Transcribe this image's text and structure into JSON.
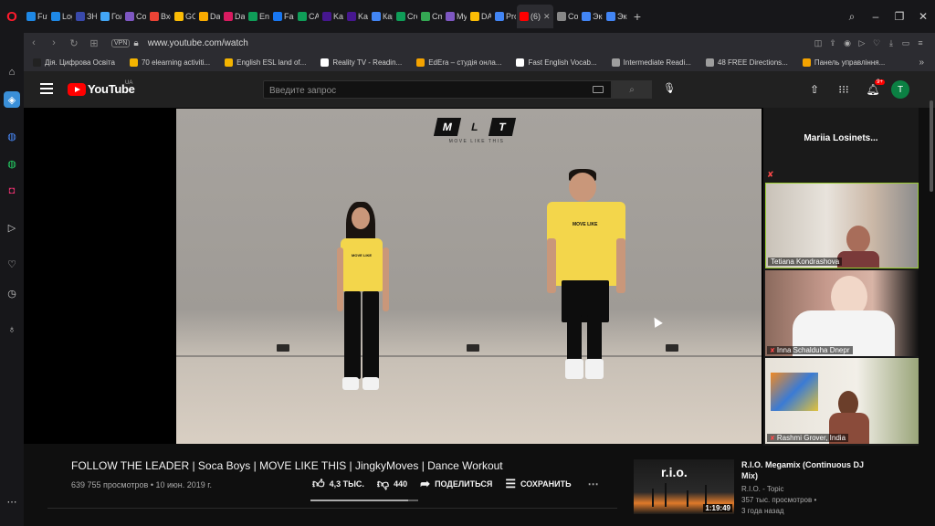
{
  "browser": {
    "tabs": [
      {
        "label": "Fut",
        "color": "#1e88e5"
      },
      {
        "label": "Log",
        "color": "#1e88e5"
      },
      {
        "label": "ЗНО",
        "color": "#3949ab"
      },
      {
        "label": "Гол",
        "color": "#42a5f5"
      },
      {
        "label": "Col",
        "color": "#7e57c2"
      },
      {
        "label": "Вхо",
        "color": "#ea4335"
      },
      {
        "label": "GO",
        "color": "#fbbc05"
      },
      {
        "label": "Day",
        "color": "#f9ab00"
      },
      {
        "label": "Das",
        "color": "#d81b60"
      },
      {
        "label": "Ene",
        "color": "#0f9d58"
      },
      {
        "label": "Fac",
        "color": "#1877f2"
      },
      {
        "label": "CAI",
        "color": "#0f9d58"
      },
      {
        "label": "Kah",
        "color": "#46178f"
      },
      {
        "label": "Kah",
        "color": "#46178f"
      },
      {
        "label": "Кар",
        "color": "#4285f4"
      },
      {
        "label": "Cre",
        "color": "#0f9d58"
      },
      {
        "label": "Cm",
        "color": "#34a853"
      },
      {
        "label": "My",
        "color": "#7e57c2"
      },
      {
        "label": "DAY",
        "color": "#fbbc05"
      },
      {
        "label": "Pro",
        "color": "#4285f4"
      },
      {
        "label": "(6)",
        "color": "#ff0000",
        "active": true
      },
      {
        "label": "Col",
        "color": "#888888"
      },
      {
        "label": "Экс",
        "color": "#4285f4"
      },
      {
        "label": "Экс",
        "color": "#4285f4"
      }
    ],
    "tab_close": "✕",
    "new_tab": "+",
    "url": "www.youtube.com/watch",
    "vpn_label": "VPN",
    "bookmarks": [
      {
        "label": "Дія. Цифрова Освіта",
        "color": "#222222"
      },
      {
        "label": "70 elearning activiti...",
        "color": "#f4b400"
      },
      {
        "label": "English ESL land of...",
        "color": "#f4b400"
      },
      {
        "label": "Reality TV - Readin...",
        "color": "#ffffff"
      },
      {
        "label": "EdEra – студія онла...",
        "color": "#f4a300"
      },
      {
        "label": "Fast English Vocab...",
        "color": "#ffffff"
      },
      {
        "label": "Intermediate Readi...",
        "color": "#9e9e9e"
      },
      {
        "label": "48 FREE Directions...",
        "color": "#9e9e9e"
      },
      {
        "label": "Панель управління...",
        "color": "#f4a300"
      }
    ],
    "bookmarks_more": "»"
  },
  "youtube": {
    "logo_text": "YouTube",
    "region": "UA",
    "search_placeholder": "Введите запрос",
    "notification_count": "9+",
    "avatar_letter": "T",
    "mlt_letters": [
      "M",
      "L",
      "T"
    ],
    "mlt_sub": "MOVE LIKE THIS",
    "shirt_text": "MOVE LIKE",
    "video_title": "FOLLOW THE LEADER | Soca Boys | MOVE LIKE THIS | JingkyMoves | Dance Workout",
    "video_meta": "639 755 просмотров • 10 июн. 2019 г.",
    "like_count": "4,3 ТЫС.",
    "dislike_count": "440",
    "share_label": "ПОДЕЛИТЬСЯ",
    "save_label": "СОХРАНИТЬ",
    "like_ratio": 0.907
  },
  "zoom": {
    "host_name": "Mariia  Losinets...",
    "participants": [
      {
        "name": "Tetiana Kondrashova",
        "muted": false,
        "active": true
      },
      {
        "name": "Inna Schalduha Dnepr",
        "muted": true,
        "active": false
      },
      {
        "name": "Rashmi Grover, India",
        "muted": true,
        "active": false
      }
    ]
  },
  "recommendation": {
    "thumb_text": "r.i.o.",
    "duration": "1:19:49",
    "title": "R.I.O. Megamix (Continuous DJ Mix)",
    "channel": "R.I.O. - Topic",
    "views": "357 тыс. просмотров •",
    "age": "3 года назад"
  }
}
